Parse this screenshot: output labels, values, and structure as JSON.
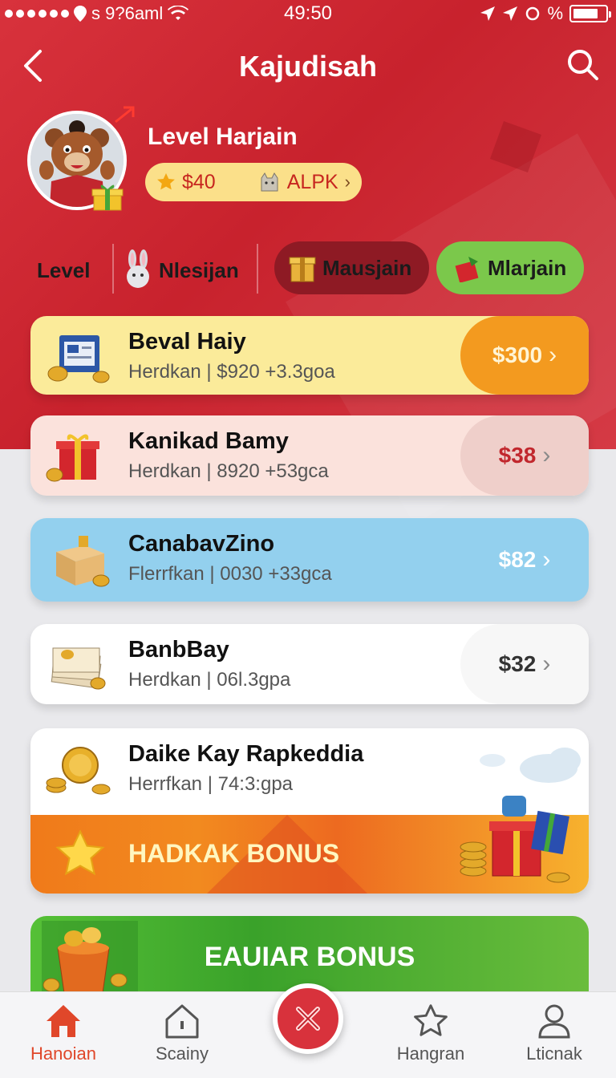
{
  "status_bar": {
    "carrier": "s 9?6aml",
    "time": "49:50",
    "battery_label": "%"
  },
  "header": {
    "title": "Kajudisah"
  },
  "profile": {
    "level_title": "Level Harjain",
    "balance": "$40",
    "currency_label": "ALPK"
  },
  "tabs": [
    {
      "label": "Level"
    },
    {
      "label": "Nlesijan"
    },
    {
      "label": "Mausjain"
    },
    {
      "label": "Mlarjain"
    }
  ],
  "cards": [
    {
      "name": "Beval Haiy",
      "sub": "Herdkan | $920  +3.3goa",
      "reward": "$300"
    },
    {
      "name": "Kanikad Bamy",
      "sub": "Herdkan | 8920  +53gca",
      "reward": "$38"
    },
    {
      "name": "CanabavZino",
      "sub": "Flerrfkan | 0030  +33gca",
      "reward": "$82"
    },
    {
      "name": "BanbBay",
      "sub": "Herdkan | 06l.3gpa",
      "reward": "$32"
    },
    {
      "name": "Daike Kay Rapkeddia",
      "sub": "Herrfkan | 74:3:gpa"
    }
  ],
  "bonus_banner": {
    "label": "HADKAK BONUS"
  },
  "green_banner": {
    "label": "EAUIAR BONUS"
  },
  "bottom_nav": [
    {
      "label": "Hanoian"
    },
    {
      "label": "Scainy"
    },
    {
      "label": "Hangran"
    },
    {
      "label": "Lticnak"
    }
  ],
  "colors": {
    "brand_red": "#d8323c",
    "active_tab": "#e0472a",
    "gold": "#fbe08a"
  }
}
